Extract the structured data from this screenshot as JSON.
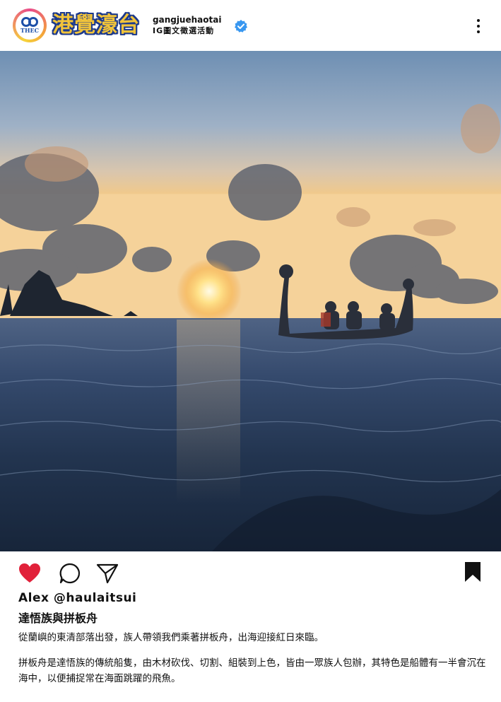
{
  "header": {
    "logo_text": "THEC",
    "brand_title": "港覺濠台",
    "username": "gangjuehaotai",
    "subtitle": "IG圖文徵選活動",
    "verified_icon": "verified-badge-icon",
    "more_icon": "more-options-icon"
  },
  "photo": {
    "description_icon": "sunset-ocean-canoe-photo"
  },
  "actions": {
    "like_icon": "heart-icon",
    "comment_icon": "comment-icon",
    "share_icon": "send-icon",
    "save_icon": "bookmark-icon",
    "like_color": "#e1213a"
  },
  "post": {
    "author": "Alex @haulaitsui",
    "title": "達悟族與拼板舟",
    "paragraph1": "從蘭嶼的東清部落出發，族人帶領我們乘著拼板舟，出海迎接紅日來臨。",
    "paragraph2": "拼板舟是達悟族的傳統船隻，由木材砍伐、切割、組裝到上色，皆由一眾族人包辦，其特色是船體有一半會沉在海中，以便捕捉常在海面跳躍的飛魚。"
  },
  "colors": {
    "brand_yellow": "#f2c43a",
    "brand_blue": "#1d3a8c",
    "verified_blue": "#3897f0"
  }
}
